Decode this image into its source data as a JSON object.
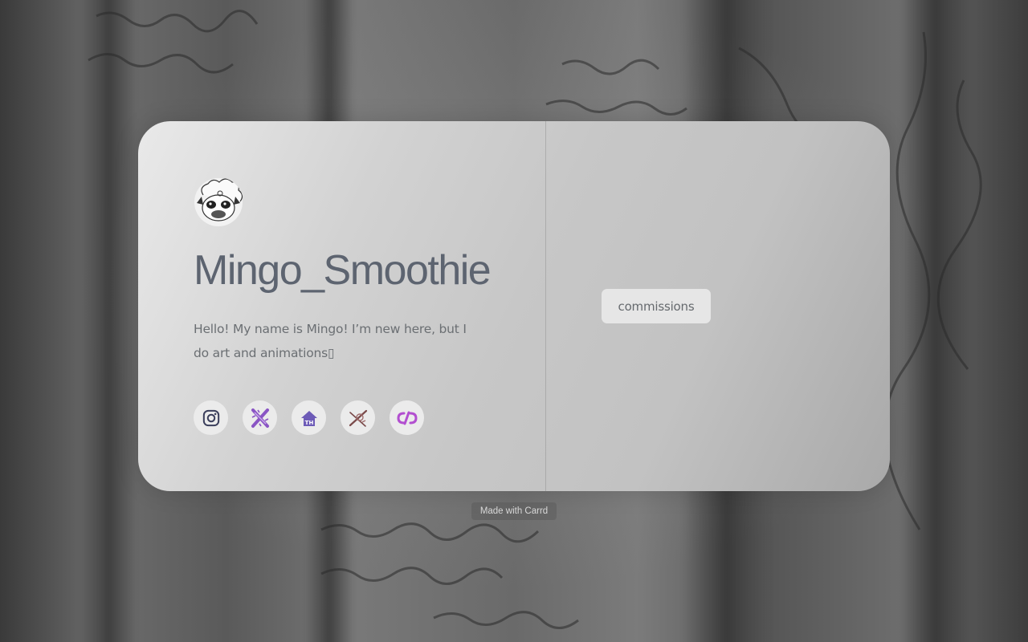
{
  "profile": {
    "name": "Mingo_Smoothie",
    "bio": "Hello! My name is Mingo! I’m new here, but I do art and animations▯",
    "avatar_icon": "sheep-avatar-icon"
  },
  "socials": [
    {
      "icon": "instagram-icon",
      "color": "#3b3f5c"
    },
    {
      "icon": "x-logo-icon",
      "color": "#8a55c4"
    },
    {
      "icon": "toyhouse-icon",
      "color": "#6d5bb7"
    },
    {
      "icon": "artfight-icon",
      "color": "#7a4a4a"
    },
    {
      "icon": "picarto-icon",
      "color": "#b24fd0"
    }
  ],
  "buttons": {
    "commissions": "commissions"
  },
  "footer": {
    "credit": "Made with Carrd"
  }
}
